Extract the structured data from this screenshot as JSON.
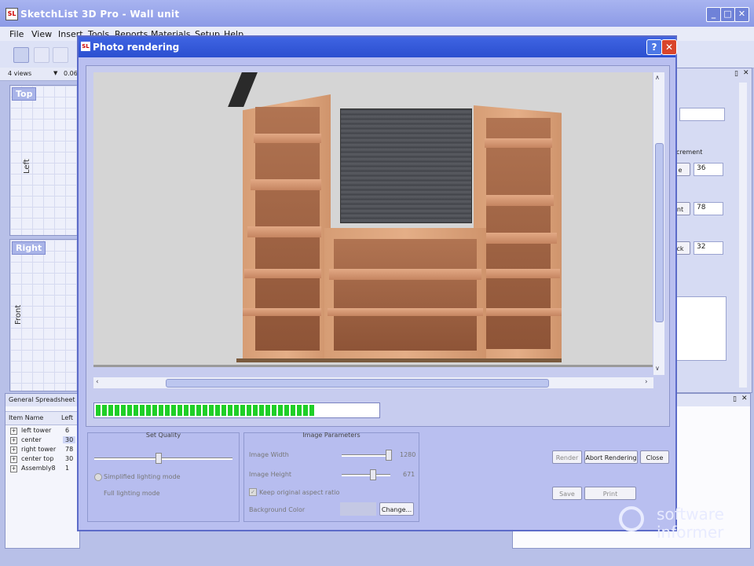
{
  "main_window": {
    "title": "SketchList 3D Pro - Wall unit",
    "app_icon": "SL",
    "min": "_",
    "max": "□",
    "close": "✕"
  },
  "menu": [
    "File",
    "View",
    "Insert",
    "Tools",
    "Reports",
    "Materials",
    "Setup",
    "Help"
  ],
  "views": {
    "label": "4 views",
    "zoom": "0.06"
  },
  "panes": {
    "top": "Top",
    "left": "Left",
    "right": "Right",
    "front": "Front"
  },
  "spreadsheet": {
    "title": "General Spreadsheet",
    "headers": [
      "Item Name",
      "Left"
    ],
    "rows": [
      {
        "name": "left tower",
        "value": "6"
      },
      {
        "name": "center",
        "value": "30"
      },
      {
        "name": "right tower",
        "value": "78"
      },
      {
        "name": "center top",
        "value": "30"
      },
      {
        "name": "Assembly8",
        "value": "1"
      }
    ]
  },
  "right_panel": {
    "section": "crement",
    "fields": [
      {
        "label": "e",
        "value": "36"
      },
      {
        "label": "nt",
        "value": "78"
      },
      {
        "label": "ck",
        "value": "32"
      }
    ]
  },
  "dialog": {
    "title": "Photo rendering",
    "help": "?",
    "close": "✕",
    "progress": 0.78,
    "set_quality": {
      "title": "Set Quality",
      "simplified": "Simplified lighting mode",
      "full": "Full lighting mode",
      "level": 0.46
    },
    "image_params": {
      "title": "Image Parameters",
      "width_label": "Image Width",
      "width_value": "1280",
      "height_label": "Image Height",
      "height_value": "671",
      "keep_aspect": "Keep original aspect ratio",
      "bg_label": "Background Color",
      "change": "Change..."
    },
    "buttons": {
      "render": "Render",
      "abort": "Abort Rendering",
      "close": "Close",
      "save": "Save",
      "print": "Print"
    }
  },
  "watermark": {
    "line1": "software",
    "line2": "informer"
  }
}
